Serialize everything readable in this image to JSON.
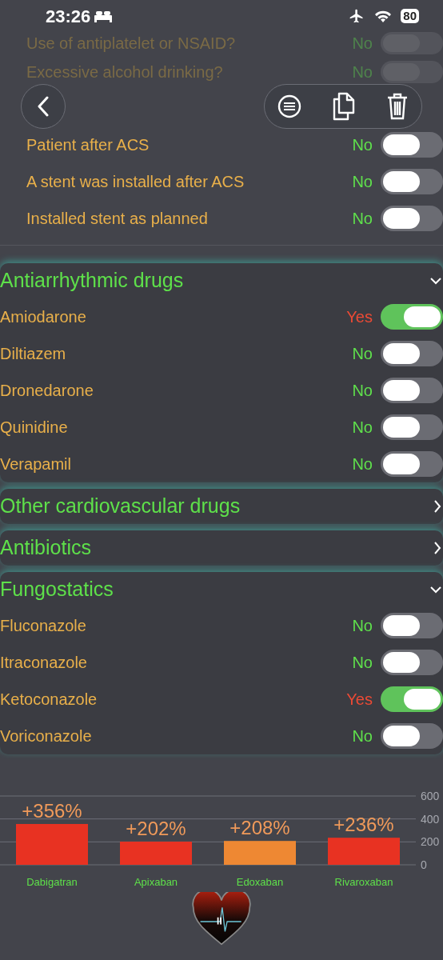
{
  "status_bar": {
    "time": "23:26",
    "battery": "80"
  },
  "faded_rows": [
    {
      "label": "Use of antiplatelet or NSAID?",
      "answer": "No",
      "on": false
    },
    {
      "label": "Excessive alcohol drinking?",
      "answer": "No",
      "on": false
    }
  ],
  "top_rows": [
    {
      "label": "Patient after ACS",
      "answer": "No",
      "on": false
    },
    {
      "label": "A stent was installed after ACS",
      "answer": "No",
      "on": false
    },
    {
      "label": "Installed stent as planned",
      "answer": "No",
      "on": false
    }
  ],
  "sections": [
    {
      "title": "Antiarrhythmic drugs",
      "expanded": true,
      "items": [
        {
          "label": "Amiodarone",
          "answer": "Yes",
          "on": true
        },
        {
          "label": "Diltiazem",
          "answer": "No",
          "on": false
        },
        {
          "label": "Dronedarone",
          "answer": "No",
          "on": false
        },
        {
          "label": "Quinidine",
          "answer": "No",
          "on": false
        },
        {
          "label": "Verapamil",
          "answer": "No",
          "on": false
        }
      ]
    },
    {
      "title": "Other cardiovascular drugs",
      "expanded": false
    },
    {
      "title": "Antibiotics",
      "expanded": false
    },
    {
      "title": "Fungostatics",
      "expanded": true,
      "items": [
        {
          "label": "Fluconazole",
          "answer": "No",
          "on": false
        },
        {
          "label": "Itraconazole",
          "answer": "No",
          "on": false
        },
        {
          "label": "Ketoconazole",
          "answer": "Yes",
          "on": true
        },
        {
          "label": "Voriconazole",
          "answer": "No",
          "on": false
        }
      ]
    }
  ],
  "chart_data": {
    "type": "bar",
    "categories": [
      "Dabigatran",
      "Apixaban",
      "Edoxaban",
      "Rivaroxaban"
    ],
    "series": [
      {
        "color": "#e83222",
        "values": [
          356,
          202,
          null,
          236
        ]
      },
      {
        "color": "#ee8833",
        "values": [
          null,
          null,
          208,
          null
        ]
      }
    ],
    "value_labels": [
      "+356%",
      "+202%",
      "+208%",
      "+236%"
    ],
    "ylim": [
      0,
      600
    ],
    "yticks": [
      0,
      200,
      400,
      600
    ]
  }
}
